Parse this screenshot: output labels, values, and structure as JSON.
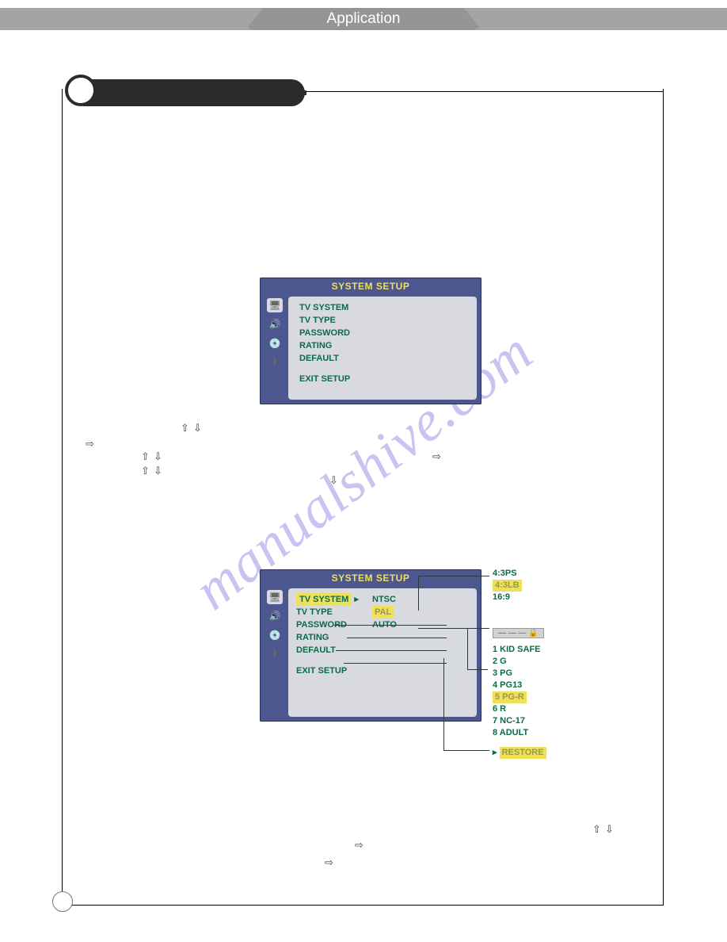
{
  "header": {
    "title": "Application"
  },
  "osd1": {
    "title": "SYSTEM SETUP",
    "items": [
      "TV SYSTEM",
      "TV TYPE",
      "PASSWORD",
      "RATING",
      "DEFAULT"
    ],
    "exit": "EXIT SETUP"
  },
  "osd2": {
    "title": "SYSTEM SETUP",
    "items": {
      "tv_system": "TV SYSTEM",
      "tv_type": "TV TYPE",
      "password": "PASSWORD",
      "rating": "RATING",
      "default": "DEFAULT",
      "exit": "EXIT SETUP"
    },
    "tv_system_opts": {
      "a": "NTSC",
      "b": "PAL",
      "c": "AUTO"
    },
    "tv_type_opts": {
      "a": "4:3PS",
      "b": "4:3LB",
      "c": "16:9"
    },
    "password_box": "— — — 🔒",
    "rating_opts": {
      "r1": "1 KID SAFE",
      "r2": "2 G",
      "r3": "3 PG",
      "r4": "4 PG13",
      "r5": "5 PG-R",
      "r6": "6 R",
      "r7": "7 NC-17",
      "r8": "8 ADULT"
    },
    "default_opt": "RESTORE"
  },
  "arrows": {
    "up": "⇧",
    "down": "⇩",
    "left": "⇦",
    "right": "⇨"
  },
  "watermark": "manualshive.com"
}
